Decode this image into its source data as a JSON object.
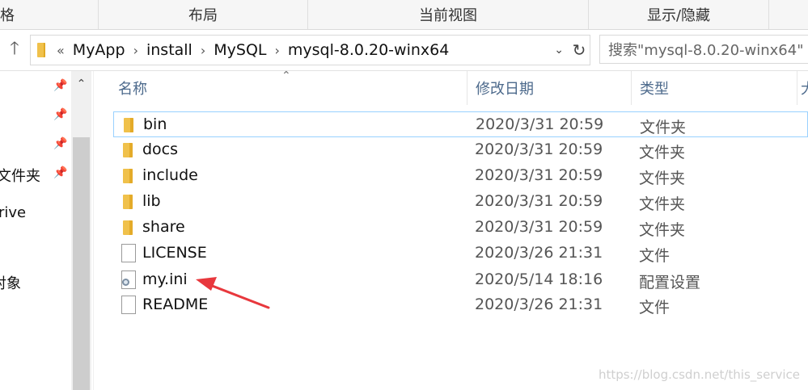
{
  "ribbon": {
    "groups": [
      "格",
      "布局",
      "当前视图",
      "显示/隐藏"
    ]
  },
  "address": {
    "overflow_marker": "«",
    "breadcrumb": [
      "MyApp",
      "install",
      "MySQL",
      "mysql-8.0.20-winx64"
    ],
    "search_placeholder": "搜索\"mysql-8.0.20-winx64\""
  },
  "nav_pane": {
    "items": [
      "文件夹",
      "rive",
      "对象"
    ]
  },
  "columns": {
    "name": "名称",
    "modified": "修改日期",
    "type": "类型",
    "size": "大"
  },
  "files": [
    {
      "name": "bin",
      "modified": "2020/3/31 20:59",
      "type": "文件夹",
      "icon": "folder-icon"
    },
    {
      "name": "docs",
      "modified": "2020/3/31 20:59",
      "type": "文件夹",
      "icon": "folder-icon"
    },
    {
      "name": "include",
      "modified": "2020/3/31 20:59",
      "type": "文件夹",
      "icon": "folder-icon"
    },
    {
      "name": "lib",
      "modified": "2020/3/31 20:59",
      "type": "文件夹",
      "icon": "folder-icon"
    },
    {
      "name": "share",
      "modified": "2020/3/31 20:59",
      "type": "文件夹",
      "icon": "folder-icon"
    },
    {
      "name": "LICENSE",
      "modified": "2020/3/26 21:31",
      "type": "文件",
      "icon": "document-icon"
    },
    {
      "name": "my.ini",
      "modified": "2020/5/14 18:16",
      "type": "配置设置",
      "icon": "config-file-icon"
    },
    {
      "name": "README",
      "modified": "2020/3/26 21:31",
      "type": "文件",
      "icon": "document-icon"
    }
  ],
  "watermark": "https://blog.csdn.net/this_service",
  "colors": {
    "selection_border": "#99d1ff",
    "annotation_arrow": "#e8383d",
    "header_text": "#4d6a8c"
  }
}
